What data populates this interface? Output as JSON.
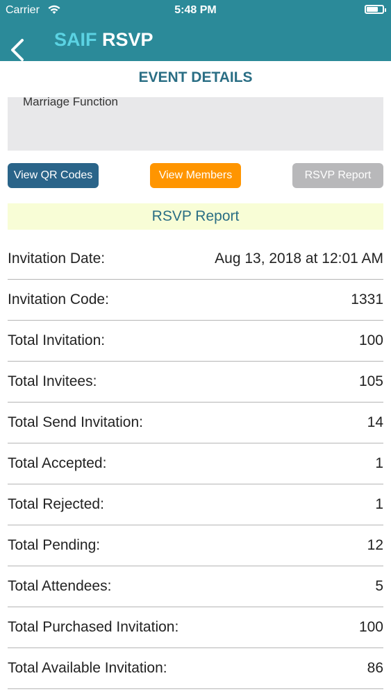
{
  "status": {
    "carrier": "Carrier",
    "time": "5:48 PM"
  },
  "nav": {
    "title_part1": "SAIF",
    "title_part2": "RSVP"
  },
  "section_title": "EVENT DETAILS",
  "event_description": "Marriage Function",
  "buttons": {
    "qr": "View QR Codes",
    "members": "View Members",
    "report": "RSVP Report"
  },
  "report_header": "RSVP Report",
  "rows": [
    {
      "label": "Invitation Date:",
      "value": "Aug 13, 2018 at 12:01 AM"
    },
    {
      "label": "Invitation Code:",
      "value": "1331"
    },
    {
      "label": "Total Invitation:",
      "value": "100"
    },
    {
      "label": "Total Invitees:",
      "value": "105"
    },
    {
      "label": "Total Send Invitation:",
      "value": "14"
    },
    {
      "label": "Total Accepted:",
      "value": "1"
    },
    {
      "label": "Total Rejected:",
      "value": "1"
    },
    {
      "label": "Total Pending:",
      "value": "12"
    },
    {
      "label": "Total Attendees:",
      "value": "5"
    },
    {
      "label": "Total Purchased Invitation:",
      "value": "100"
    },
    {
      "label": "Total Available Invitation:",
      "value": "86"
    }
  ],
  "colors": {
    "nav_bg": "#2b8a99",
    "accent_title": "#2a6e84",
    "qr_button": "#2a6489",
    "members_button": "#ff9500",
    "report_button": "#b8b8ba",
    "report_header_bg": "#f8fdd6"
  }
}
